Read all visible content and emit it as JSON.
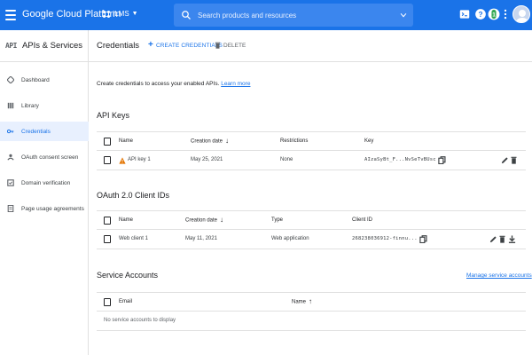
{
  "topbar": {
    "brand": "Google Cloud Platform",
    "project_name": "ILMS",
    "search_placeholder": "Search products and resources",
    "avatar_initial": "I",
    "accent": "#1a73e8"
  },
  "sidebar": {
    "badge": "API",
    "title": "APIs & Services",
    "items": [
      {
        "label": "Dashboard",
        "icon": "dashboard-icon"
      },
      {
        "label": "Library",
        "icon": "library-icon"
      },
      {
        "label": "Credentials",
        "icon": "key-icon",
        "active": true
      },
      {
        "label": "OAuth consent screen",
        "icon": "consent-icon"
      },
      {
        "label": "Domain verification",
        "icon": "checkbox-icon"
      },
      {
        "label": "Page usage agreements",
        "icon": "settings-doc-icon"
      }
    ]
  },
  "header": {
    "title": "Credentials",
    "create_label": "CREATE CREDENTIALS",
    "delete_label": "DELETE"
  },
  "intro": {
    "text": "Create credentials to access your enabled APIs.",
    "link": "Learn more"
  },
  "api_keys": {
    "title": "API Keys",
    "columns": [
      "Name",
      "Creation date",
      "Restrictions",
      "Key"
    ],
    "rows": [
      {
        "name": "API key 1",
        "date": "May 25, 2021",
        "restrictions": "None",
        "key": "AIzaSyBt_F...NvSeTvBUsc"
      }
    ]
  },
  "oauth": {
    "title": "OAuth 2.0 Client IDs",
    "columns": [
      "Name",
      "Creation date",
      "Type",
      "Client ID"
    ],
    "rows": [
      {
        "name": "Web client 1",
        "date": "May 11, 2021",
        "type": "Web application",
        "client_id": "268238036912-finnu..."
      }
    ]
  },
  "service_accounts": {
    "title": "Service Accounts",
    "manage_link": "Manage service accounts",
    "columns": [
      "Email",
      "Name"
    ],
    "empty": "No service accounts to display"
  }
}
